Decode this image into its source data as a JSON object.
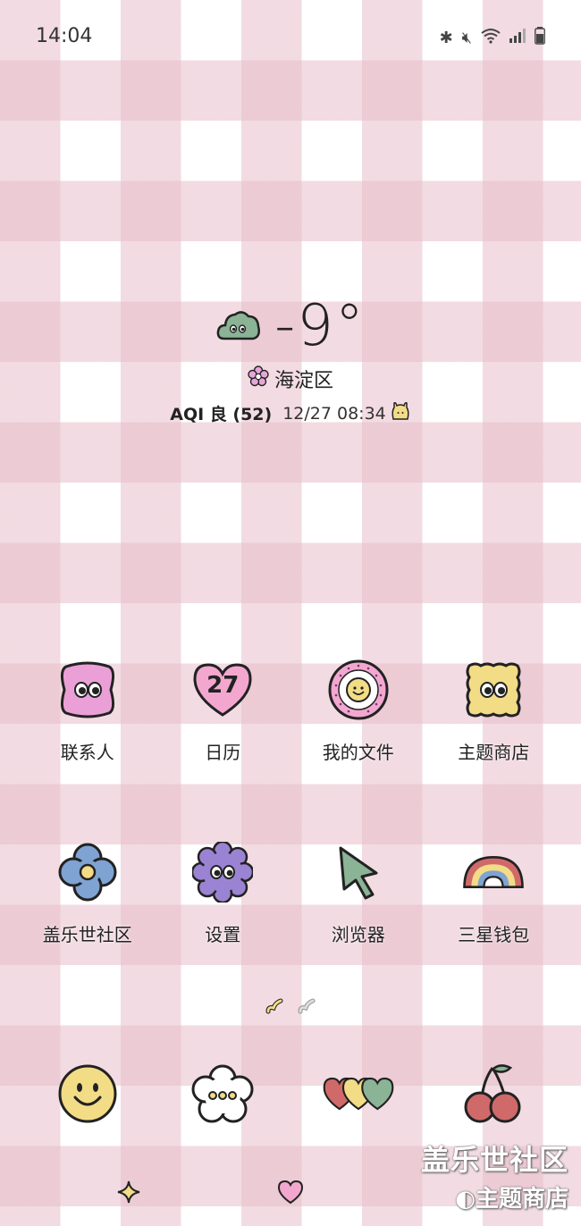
{
  "status_bar": {
    "time": "14:04"
  },
  "weather": {
    "temperature": "-9°",
    "location": "海淀区",
    "aqi": "AQI 良 (52)",
    "updated": "12/27 08:34"
  },
  "home_apps": [
    {
      "label": "联系人",
      "icon": "contacts-blob-icon"
    },
    {
      "label": "日历",
      "icon": "calendar-heart-icon",
      "badge": "27"
    },
    {
      "label": "我的文件",
      "icon": "my-files-smiley-sticker-icon"
    },
    {
      "label": "主题商店",
      "icon": "theme-store-cracker-icon"
    },
    {
      "label": "盖乐世社区",
      "icon": "flower-community-icon"
    },
    {
      "label": "设置",
      "icon": "settings-flower-icon"
    },
    {
      "label": "浏览器",
      "icon": "browser-cursor-icon"
    },
    {
      "label": "三星钱包",
      "icon": "wallet-rainbow-icon"
    }
  ],
  "dock_apps": [
    {
      "icon": "smiley-face-icon"
    },
    {
      "icon": "flower-dots-icon"
    },
    {
      "icon": "hearts-icon"
    },
    {
      "icon": "cherry-icon"
    }
  ],
  "watermark": {
    "line1": "盖乐世社区",
    "line2": "主题商店"
  },
  "colors": {
    "pink_check": "#E7BECA",
    "blob_pink": "#EAA0D6",
    "heart_pink": "#F3A7CF",
    "yellow": "#F2DC86",
    "blue": "#7FA3D2",
    "purple": "#9B83D3",
    "green": "#8BB396",
    "rainbow_red": "#D06A6A"
  }
}
